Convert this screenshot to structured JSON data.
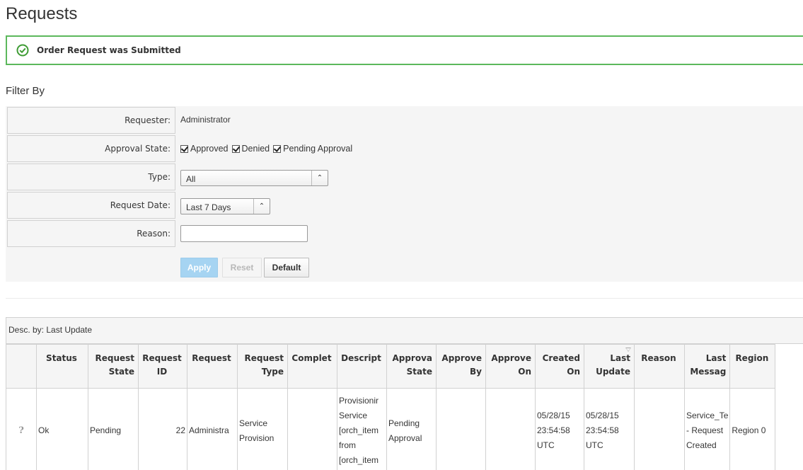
{
  "page": {
    "title": "Requests"
  },
  "alert": {
    "message": "Order Request was Submitted",
    "status": "success",
    "color": "#5cb85c"
  },
  "filter": {
    "heading": "Filter By",
    "requester": {
      "label": "Requester:",
      "value": "Administrator"
    },
    "approval_state": {
      "label": "Approval State:",
      "options": [
        {
          "label": "Approved",
          "checked": true
        },
        {
          "label": "Denied",
          "checked": true
        },
        {
          "label": "Pending Approval",
          "checked": true
        }
      ]
    },
    "type": {
      "label": "Type:",
      "selected": "All"
    },
    "request_date": {
      "label": "Request Date:",
      "selected": "Last 7 Days"
    },
    "reason": {
      "label": "Reason:",
      "value": ""
    },
    "buttons": {
      "apply": "Apply",
      "reset": "Reset",
      "default": "Default"
    }
  },
  "table": {
    "sort_text": "Desc. by: Last Update",
    "columns": [
      {
        "label": ""
      },
      {
        "label": "Status"
      },
      {
        "label": "Request",
        "label2": "State"
      },
      {
        "label": "Request",
        "label2": "ID"
      },
      {
        "label": "Request"
      },
      {
        "label": "Request",
        "label2": "Type"
      },
      {
        "label": "Complet"
      },
      {
        "label": "Descript"
      },
      {
        "label": "Approva",
        "label2": "State"
      },
      {
        "label": "Approve",
        "label2": "By"
      },
      {
        "label": "Approve",
        "label2": "On"
      },
      {
        "label": "Created",
        "label2": "On"
      },
      {
        "label": "Last",
        "label2": "Update"
      },
      {
        "label": "Reason"
      },
      {
        "label": "Last",
        "label2": "Messag"
      },
      {
        "label": "Region"
      }
    ],
    "rows": [
      {
        "icon": "question-icon",
        "status": "Ok",
        "request_state": "Pending",
        "request_id": "22",
        "request": "Administra",
        "request_type": [
          "Service",
          "Provision"
        ],
        "completed": "",
        "description": [
          "Provisionir",
          "Service",
          "[orch_item",
          "from",
          "[orch_item"
        ],
        "approval_state": [
          "Pending",
          "Approval"
        ],
        "approved_by": "",
        "approved_on": "",
        "created_on": [
          "05/28/15",
          "23:54:58",
          "UTC"
        ],
        "last_update": [
          "05/28/15",
          "23:54:58",
          "UTC"
        ],
        "reason": "",
        "last_message": [
          "Service_Te",
          "- Request",
          "Created"
        ],
        "region": "Region 0"
      }
    ]
  }
}
